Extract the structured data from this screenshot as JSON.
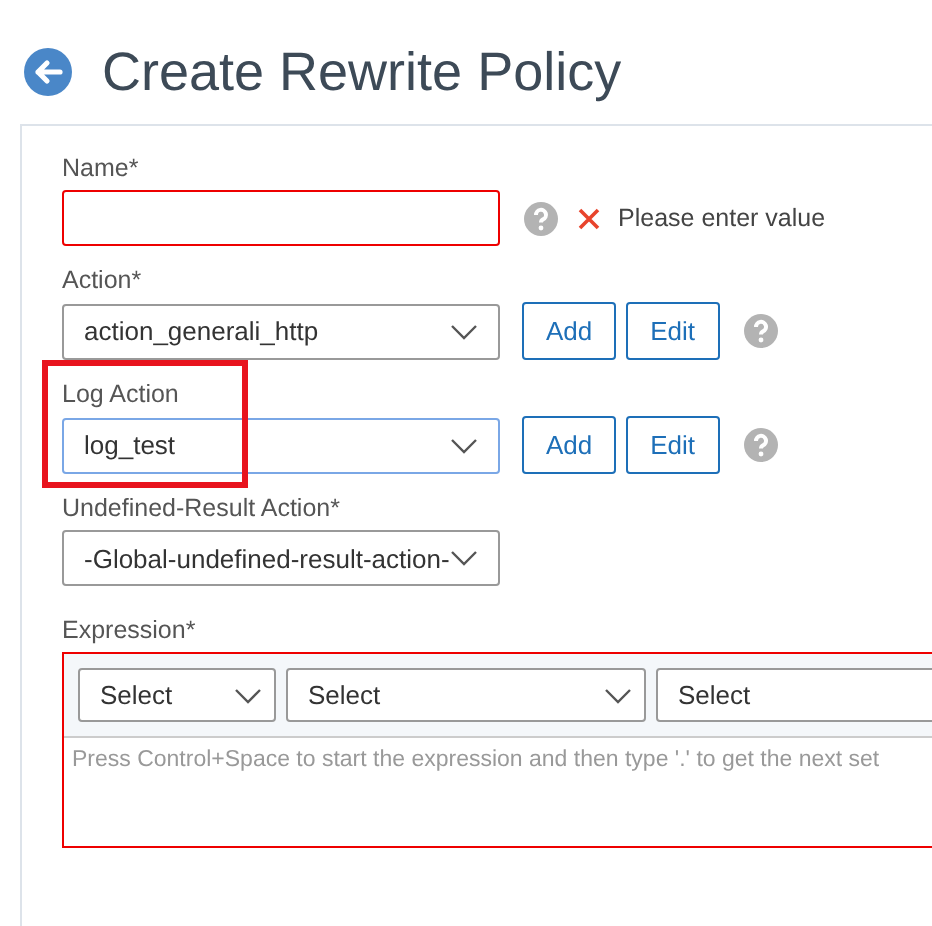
{
  "header": {
    "title": "Create Rewrite Policy"
  },
  "fields": [
    {
      "label": "Name*",
      "kind": "text",
      "error": true,
      "error_text": "Please enter value",
      "focused": false,
      "highlighted": false,
      "help": true
    },
    {
      "label": "Action*",
      "kind": "select",
      "value": "action_generali_http",
      "error": false,
      "focused": false,
      "highlighted": false,
      "buttons": [
        "Add",
        "Edit"
      ],
      "help": true
    },
    {
      "label": "Log Action",
      "kind": "select",
      "value": "log_test",
      "error": false,
      "focused": true,
      "highlighted": true,
      "buttons": [
        "Add",
        "Edit"
      ],
      "help": true
    },
    {
      "label": "Undefined-Result Action*",
      "kind": "select",
      "value": "-Global-undefined-result-action-",
      "error": false,
      "focused": false,
      "highlighted": false,
      "help": false
    }
  ],
  "expression": {
    "label": "Expression*",
    "error": true,
    "selects": [
      "Select",
      "Select",
      "Select"
    ],
    "placeholder": "Press Control+Space to start the expression and then type '.' to get the next set"
  }
}
